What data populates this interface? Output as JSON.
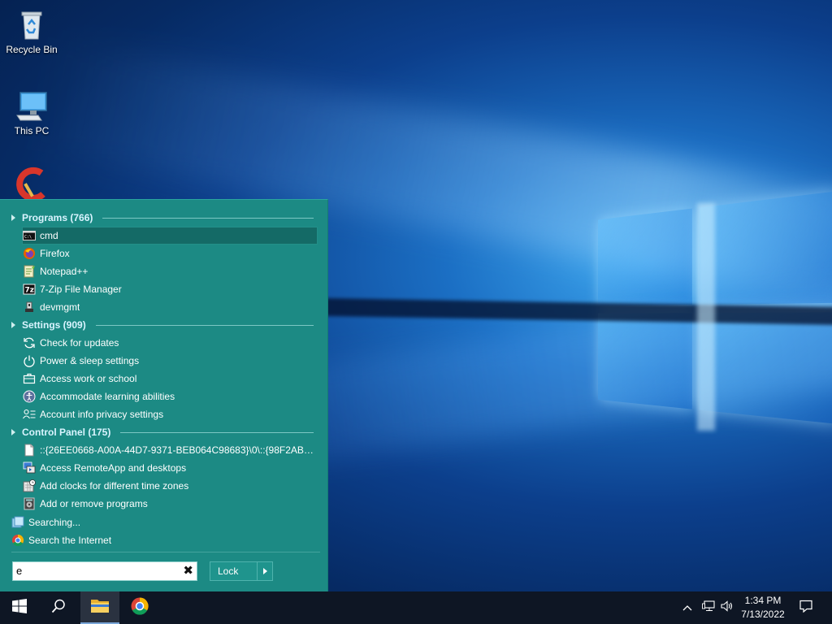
{
  "desktop": {
    "icons": [
      {
        "label": "Recycle Bin",
        "icon": "recycle-bin-icon"
      },
      {
        "label": "This PC",
        "icon": "this-pc-icon"
      },
      {
        "label": "",
        "icon": "ccleaner-icon"
      }
    ]
  },
  "start_menu": {
    "groups": {
      "programs": {
        "title": "Programs (766)",
        "items": [
          {
            "label": "cmd",
            "icon": "cmd-icon",
            "selected": true
          },
          {
            "label": "Firefox",
            "icon": "firefox-icon"
          },
          {
            "label": "Notepad++",
            "icon": "notepadpp-icon"
          },
          {
            "label": "7-Zip File Manager",
            "icon": "7zip-icon"
          },
          {
            "label": "devmgmt",
            "icon": "devmgmt-icon"
          }
        ]
      },
      "settings": {
        "title": "Settings (909)",
        "items": [
          {
            "label": "Check for updates",
            "icon": "refresh-icon"
          },
          {
            "label": "Power & sleep settings",
            "icon": "power-icon"
          },
          {
            "label": "Access work or school",
            "icon": "briefcase-icon"
          },
          {
            "label": "Accommodate learning abilities",
            "icon": "accessibility-icon"
          },
          {
            "label": "Account info privacy settings",
            "icon": "account-info-icon"
          }
        ]
      },
      "control_panel": {
        "title": "Control Panel (175)",
        "items": [
          {
            "label": "::{26EE0668-A00A-44D7-9371-BEB064C98683}\\0\\::{98F2AB62-0E...",
            "icon": "document-icon"
          },
          {
            "label": "Access RemoteApp and desktops",
            "icon": "remoteapp-icon"
          },
          {
            "label": "Add clocks for different time zones",
            "icon": "clock-icon"
          },
          {
            "label": "Add or remove programs",
            "icon": "programs-icon"
          }
        ]
      }
    },
    "searching_label": "Searching...",
    "search_internet_label": "Search the Internet",
    "search": {
      "value": "e"
    },
    "lock_label": "Lock"
  },
  "taskbar": {
    "buttons": [
      "start-icon",
      "search-icon",
      "file-explorer-icon",
      "chrome-icon"
    ],
    "tray_icons": [
      "chevron-up-icon",
      "network-icon",
      "volume-icon"
    ],
    "time": "1:34 PM",
    "date": "7/13/2022",
    "notification_icon": "notification-icon"
  },
  "colors": {
    "menu_bg": "#1c8a84",
    "taskbar_bg": "#0e1624",
    "group_title": "#d9f4ff"
  }
}
